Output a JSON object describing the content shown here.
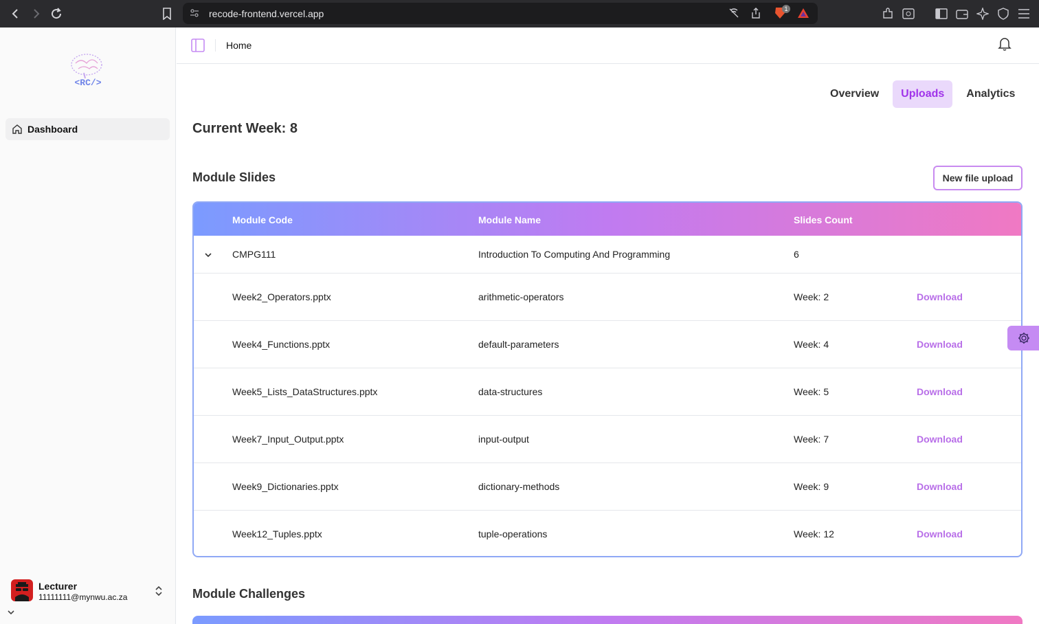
{
  "browser": {
    "url": "recode-frontend.vercel.app",
    "shield_badge": "1"
  },
  "sidebar": {
    "items": [
      {
        "label": "Dashboard"
      }
    ],
    "user": {
      "name": "Lecturer",
      "email": "11111111@mynwu.ac.za"
    },
    "logo_text": "<RC/>"
  },
  "header": {
    "breadcrumb": "Home"
  },
  "tabs": [
    {
      "label": "Overview",
      "active": false
    },
    {
      "label": "Uploads",
      "active": true
    },
    {
      "label": "Analytics",
      "active": false
    }
  ],
  "current_week": "Current Week: 8",
  "slides_section": {
    "title": "Module Slides",
    "upload_button": "New file upload",
    "columns": [
      "Module Code",
      "Module Name",
      "Slides Count"
    ],
    "module": {
      "code": "CMPG111",
      "name": "Introduction To Computing And Programming",
      "count": "6"
    },
    "files": [
      {
        "file": "Week2_Operators.pptx",
        "topic": "arithmetic-operators",
        "week": "Week: 2",
        "action": "Download"
      },
      {
        "file": "Week4_Functions.pptx",
        "topic": "default-parameters",
        "week": "Week: 4",
        "action": "Download"
      },
      {
        "file": "Week5_Lists_DataStructures.pptx",
        "topic": "data-structures",
        "week": "Week: 5",
        "action": "Download"
      },
      {
        "file": "Week7_Input_Output.pptx",
        "topic": "input-output",
        "week": "Week: 7",
        "action": "Download"
      },
      {
        "file": "Week9_Dictionaries.pptx",
        "topic": "dictionary-methods",
        "week": "Week: 9",
        "action": "Download"
      },
      {
        "file": "Week12_Tuples.pptx",
        "topic": "tuple-operations",
        "week": "Week: 12",
        "action": "Download"
      }
    ]
  },
  "challenges_section": {
    "title": "Module Challenges"
  },
  "colors": {
    "accent": "#a033ea",
    "tab_active_bg": "#ead9fb",
    "download": "#b86ee8",
    "avatar": "#d21f1f"
  }
}
